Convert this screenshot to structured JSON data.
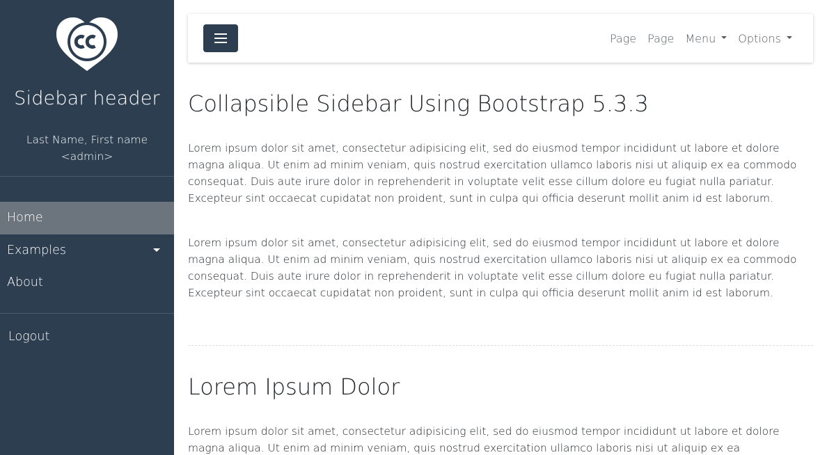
{
  "sidebar": {
    "logo_icon": "creative-commons-heart-logo",
    "title": "Sidebar header",
    "user_name": "Last Name, First name",
    "user_role": "<admin>",
    "nav": {
      "home": "Home",
      "examples": "Examples",
      "about": "About"
    },
    "logout": "Logout",
    "colors": {
      "background": "#2c3e50",
      "active_item": "#6c757d"
    }
  },
  "navbar": {
    "toggle_icon": "hamburger-icon",
    "links": {
      "page1": "Page",
      "page2": "Page",
      "menu": "Menu",
      "options": "Options"
    }
  },
  "main": {
    "title": "Collapsible Sidebar Using Bootstrap 5.3.3",
    "paragraph1": "Lorem ipsum dolor sit amet, consectetur adipisicing elit, sed do eiusmod tempor incididunt ut labore et dolore magna aliqua. Ut enim ad minim veniam, quis nostrud exercitation ullamco laboris nisi ut aliquip ex ea commodo consequat. Duis aute irure dolor in reprehenderit in voluptate velit esse cillum dolore eu fugiat nulla pariatur. Excepteur sint occaecat cupidatat non proident, sunt in culpa qui officia deserunt mollit anim id est laborum.",
    "paragraph2": "Lorem ipsum dolor sit amet, consectetur adipisicing elit, sed do eiusmod tempor incididunt ut labore et dolore magna aliqua. Ut enim ad minim veniam, quis nostrud exercitation ullamco laboris nisi ut aliquip ex ea commodo consequat. Duis aute irure dolor in reprehenderit in voluptate velit esse cillum dolore eu fugiat nulla pariatur. Excepteur sint occaecat cupidatat non proident, sunt in culpa qui officia deserunt mollit anim id est laborum.",
    "section_title": "Lorem Ipsum Dolor",
    "paragraph3": "Lorem ipsum dolor sit amet, consectetur adipisicing elit, sed do eiusmod tempor incididunt ut labore et dolore magna aliqua. Ut enim ad minim veniam, quis nostrud exercitation ullamco laboris nisi ut aliquip ex ea"
  }
}
